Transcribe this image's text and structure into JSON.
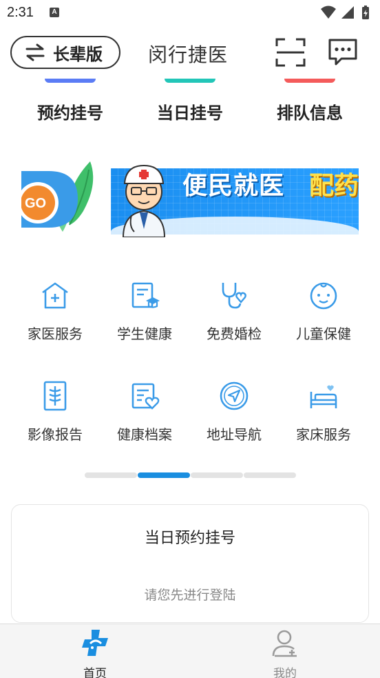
{
  "status_bar": {
    "time": "2:31",
    "notification_letter": "A"
  },
  "header": {
    "elder_mode_label": "长辈版",
    "title": "闵行捷医"
  },
  "quick_entries": [
    {
      "label": "预约挂号",
      "color": "#5b7cf5"
    },
    {
      "label": "当日挂号",
      "color": "#22c6b8"
    },
    {
      "label": "排队信息",
      "color": "#f45b5b"
    }
  ],
  "banner": {
    "go_label": "GO",
    "text_main": "便民就医",
    "text_accent": "配药"
  },
  "services": [
    {
      "label": "家医服务",
      "icon": "home-plus-icon"
    },
    {
      "label": "学生健康",
      "icon": "graduation-doc-icon"
    },
    {
      "label": "免费婚检",
      "icon": "stethoscope-heart-icon"
    },
    {
      "label": "儿童保健",
      "icon": "baby-face-icon"
    },
    {
      "label": "影像报告",
      "icon": "xray-icon"
    },
    {
      "label": "健康档案",
      "icon": "health-record-icon"
    },
    {
      "label": "地址导航",
      "icon": "navigation-icon"
    },
    {
      "label": "家床服务",
      "icon": "home-bed-icon"
    }
  ],
  "pager": {
    "pages": 4,
    "active": 1
  },
  "appointment_card": {
    "title": "当日预约挂号",
    "hint": "请您先进行登陆"
  },
  "bottom_nav": [
    {
      "label": "首页",
      "active": true,
      "icon": "home-logo-icon"
    },
    {
      "label": "我的",
      "active": false,
      "icon": "user-icon"
    }
  ],
  "colors": {
    "accent": "#1a8ee0",
    "icon_blue": "#3a9be8",
    "text_dark": "#222222",
    "text_muted": "#888888"
  }
}
